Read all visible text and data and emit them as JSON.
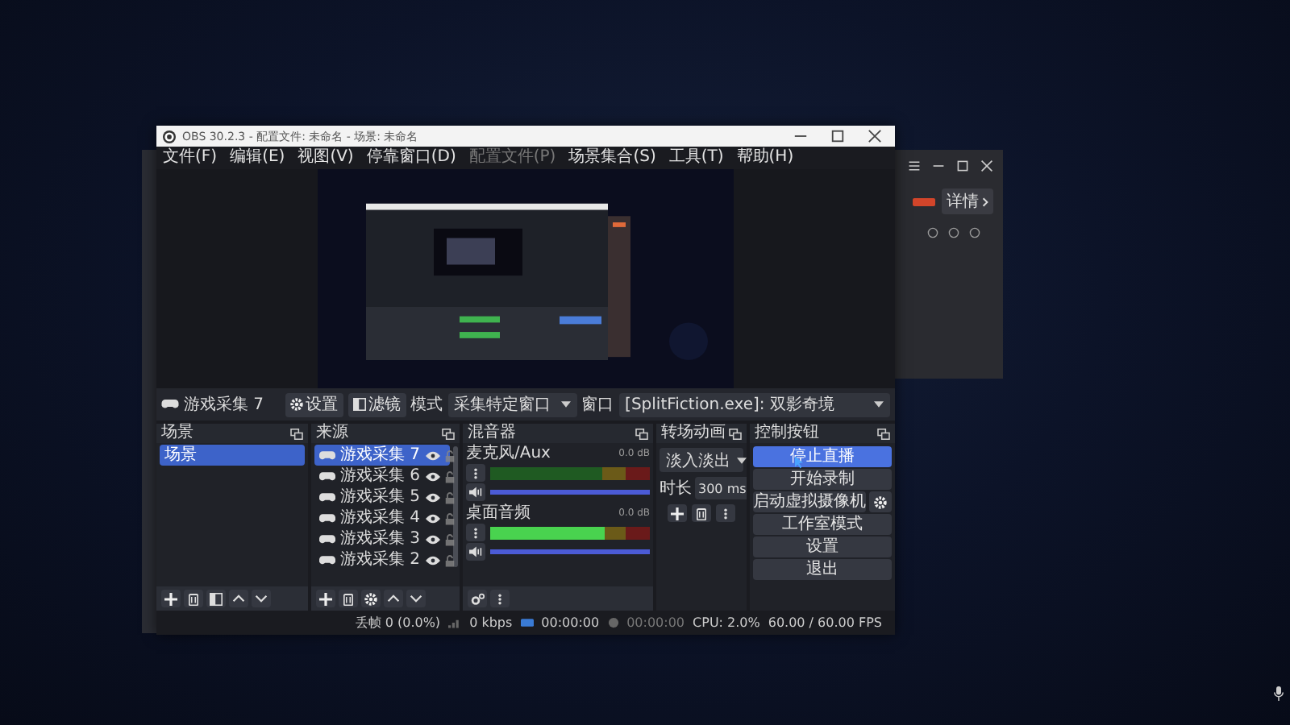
{
  "window": {
    "title": "OBS 30.2.3 - 配置文件: 未命名 - 场景: 未命名"
  },
  "menu": [
    {
      "label": "文件(F)",
      "disabled": false
    },
    {
      "label": "编辑(E)",
      "disabled": false
    },
    {
      "label": "视图(V)",
      "disabled": false
    },
    {
      "label": "停靠窗口(D)",
      "disabled": false
    },
    {
      "label": "配置文件(P)",
      "disabled": true
    },
    {
      "label": "场景集合(S)",
      "disabled": false
    },
    {
      "label": "工具(T)",
      "disabled": false
    },
    {
      "label": "帮助(H)",
      "disabled": false
    }
  ],
  "source_toolbar": {
    "source": "游戏采集 7",
    "buttons": [
      {
        "label": "设置",
        "kind": "gear"
      },
      {
        "label": "滤镜",
        "kind": "filter"
      }
    ],
    "mode_label": "模式",
    "mode": "采集特定窗口",
    "window_label": "窗口",
    "window": "[SplitFiction.exe]: 双影奇境"
  },
  "scenes": {
    "title": "场景",
    "items": [
      {
        "label": "场景",
        "selected": true
      }
    ]
  },
  "sources": {
    "title": "来源",
    "items": [
      {
        "label": "游戏采集 7",
        "selected": true,
        "visible": true,
        "locked": false
      },
      {
        "label": "游戏采集 6",
        "selected": false,
        "visible": true,
        "locked": false
      },
      {
        "label": "游戏采集 5",
        "selected": false,
        "visible": true,
        "locked": false
      },
      {
        "label": "游戏采集 4",
        "selected": false,
        "visible": true,
        "locked": false
      },
      {
        "label": "游戏采集 3",
        "selected": false,
        "visible": true,
        "locked": false
      },
      {
        "label": "游戏采集 2",
        "selected": false,
        "visible": true,
        "locked": false
      }
    ]
  },
  "mixer": {
    "title": "混音器",
    "channels": [
      {
        "name": "麦克风/Aux",
        "reading": "0.0 dB",
        "meter": {
          "level": 0
        },
        "fader": {
          "level": 1
        }
      },
      {
        "name": "桌面音频",
        "reading": "0.0 dB",
        "meter": {
          "level": 0.72
        },
        "fader": {
          "level": 1
        }
      }
    ]
  },
  "transitions": {
    "title": "转场动画",
    "transition": "淡入淡出",
    "duration_label": "时长",
    "duration": "300 ms"
  },
  "controls": {
    "title": "控制按钮",
    "buttons": [
      {
        "label": "停止直播",
        "active": true,
        "kind": "plain"
      },
      {
        "label": "开始录制",
        "active": false,
        "kind": "plain"
      },
      {
        "label": "启动虚拟摄像机",
        "active": false,
        "kind": "split"
      },
      {
        "label": "工作室模式",
        "active": false,
        "kind": "plain"
      },
      {
        "label": "设置",
        "active": false,
        "kind": "plain"
      },
      {
        "label": "退出",
        "active": false,
        "kind": "plain"
      }
    ]
  },
  "status_bar": {
    "dropped": "丢帧 0 (0.0%)",
    "bitrate": "0 kbps",
    "stream_time": "00:00:00",
    "record_time": "00:00:00",
    "cpu": "CPU: 2.0%",
    "fps": "60.00 / 60.00 FPS"
  },
  "side_window": {
    "link": "详情"
  }
}
